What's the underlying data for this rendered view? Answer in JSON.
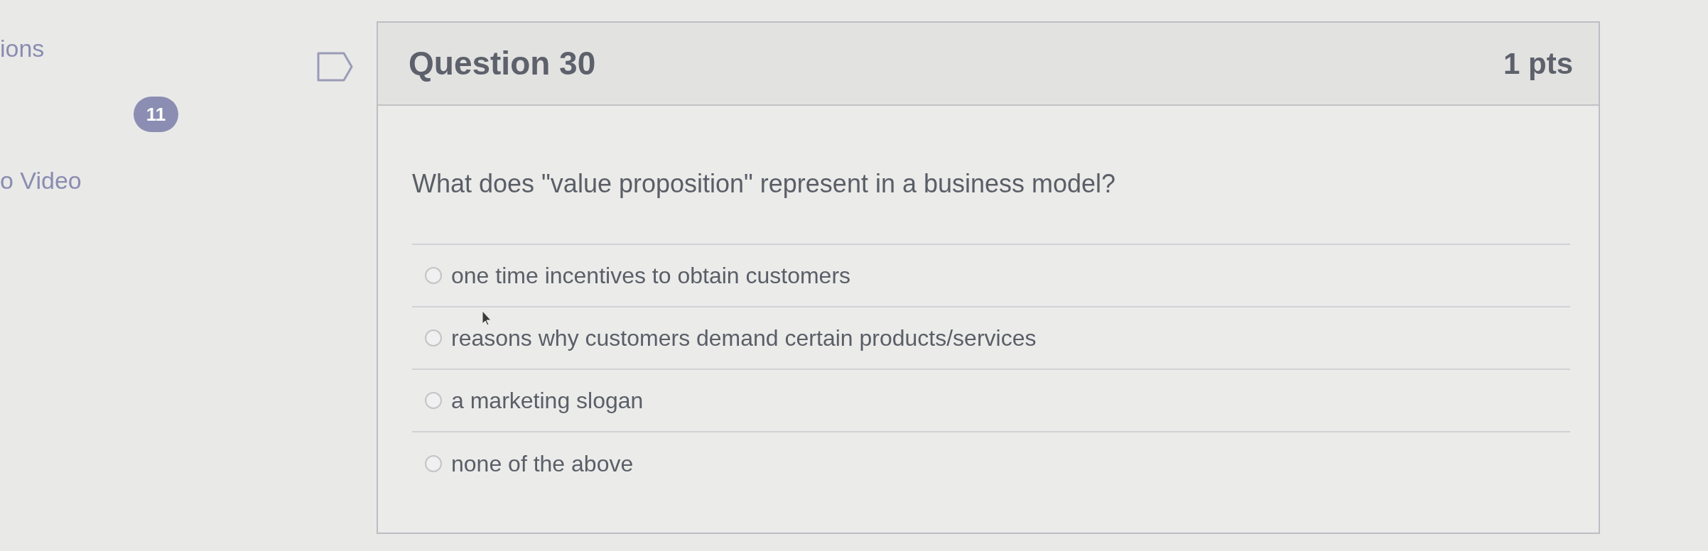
{
  "sidebar": {
    "items": [
      {
        "label": "ions",
        "badge": "11"
      },
      {
        "label": "o Video"
      }
    ]
  },
  "question": {
    "title": "Question 30",
    "points": "1 pts",
    "text": "What does \"value proposition\" represent in a business model?",
    "answers": [
      {
        "label": "one time incentives to obtain customers",
        "selected": false
      },
      {
        "label": "reasons why customers demand certain products/services",
        "selected": false
      },
      {
        "label": "a marketing slogan",
        "selected": false
      },
      {
        "label": "none of the above",
        "selected": false
      }
    ]
  }
}
